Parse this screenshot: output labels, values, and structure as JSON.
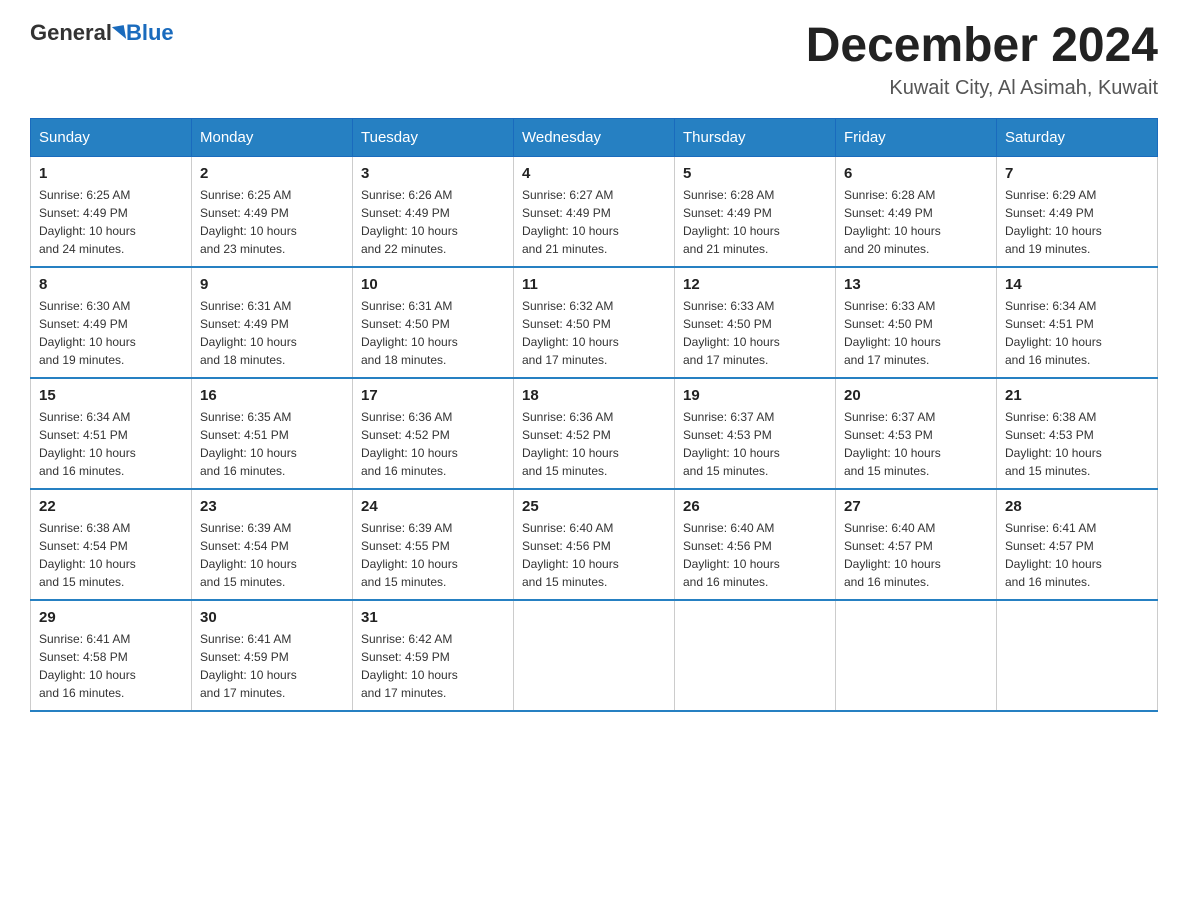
{
  "header": {
    "logo_general": "General",
    "logo_blue": "Blue",
    "month_title": "December 2024",
    "location": "Kuwait City, Al Asimah, Kuwait"
  },
  "days_of_week": [
    "Sunday",
    "Monday",
    "Tuesday",
    "Wednesday",
    "Thursday",
    "Friday",
    "Saturday"
  ],
  "weeks": [
    [
      {
        "day": "1",
        "sunrise": "6:25 AM",
        "sunset": "4:49 PM",
        "daylight": "10 hours and 24 minutes."
      },
      {
        "day": "2",
        "sunrise": "6:25 AM",
        "sunset": "4:49 PM",
        "daylight": "10 hours and 23 minutes."
      },
      {
        "day": "3",
        "sunrise": "6:26 AM",
        "sunset": "4:49 PM",
        "daylight": "10 hours and 22 minutes."
      },
      {
        "day": "4",
        "sunrise": "6:27 AM",
        "sunset": "4:49 PM",
        "daylight": "10 hours and 21 minutes."
      },
      {
        "day": "5",
        "sunrise": "6:28 AM",
        "sunset": "4:49 PM",
        "daylight": "10 hours and 21 minutes."
      },
      {
        "day": "6",
        "sunrise": "6:28 AM",
        "sunset": "4:49 PM",
        "daylight": "10 hours and 20 minutes."
      },
      {
        "day": "7",
        "sunrise": "6:29 AM",
        "sunset": "4:49 PM",
        "daylight": "10 hours and 19 minutes."
      }
    ],
    [
      {
        "day": "8",
        "sunrise": "6:30 AM",
        "sunset": "4:49 PM",
        "daylight": "10 hours and 19 minutes."
      },
      {
        "day": "9",
        "sunrise": "6:31 AM",
        "sunset": "4:49 PM",
        "daylight": "10 hours and 18 minutes."
      },
      {
        "day": "10",
        "sunrise": "6:31 AM",
        "sunset": "4:50 PM",
        "daylight": "10 hours and 18 minutes."
      },
      {
        "day": "11",
        "sunrise": "6:32 AM",
        "sunset": "4:50 PM",
        "daylight": "10 hours and 17 minutes."
      },
      {
        "day": "12",
        "sunrise": "6:33 AM",
        "sunset": "4:50 PM",
        "daylight": "10 hours and 17 minutes."
      },
      {
        "day": "13",
        "sunrise": "6:33 AM",
        "sunset": "4:50 PM",
        "daylight": "10 hours and 17 minutes."
      },
      {
        "day": "14",
        "sunrise": "6:34 AM",
        "sunset": "4:51 PM",
        "daylight": "10 hours and 16 minutes."
      }
    ],
    [
      {
        "day": "15",
        "sunrise": "6:34 AM",
        "sunset": "4:51 PM",
        "daylight": "10 hours and 16 minutes."
      },
      {
        "day": "16",
        "sunrise": "6:35 AM",
        "sunset": "4:51 PM",
        "daylight": "10 hours and 16 minutes."
      },
      {
        "day": "17",
        "sunrise": "6:36 AM",
        "sunset": "4:52 PM",
        "daylight": "10 hours and 16 minutes."
      },
      {
        "day": "18",
        "sunrise": "6:36 AM",
        "sunset": "4:52 PM",
        "daylight": "10 hours and 15 minutes."
      },
      {
        "day": "19",
        "sunrise": "6:37 AM",
        "sunset": "4:53 PM",
        "daylight": "10 hours and 15 minutes."
      },
      {
        "day": "20",
        "sunrise": "6:37 AM",
        "sunset": "4:53 PM",
        "daylight": "10 hours and 15 minutes."
      },
      {
        "day": "21",
        "sunrise": "6:38 AM",
        "sunset": "4:53 PM",
        "daylight": "10 hours and 15 minutes."
      }
    ],
    [
      {
        "day": "22",
        "sunrise": "6:38 AM",
        "sunset": "4:54 PM",
        "daylight": "10 hours and 15 minutes."
      },
      {
        "day": "23",
        "sunrise": "6:39 AM",
        "sunset": "4:54 PM",
        "daylight": "10 hours and 15 minutes."
      },
      {
        "day": "24",
        "sunrise": "6:39 AM",
        "sunset": "4:55 PM",
        "daylight": "10 hours and 15 minutes."
      },
      {
        "day": "25",
        "sunrise": "6:40 AM",
        "sunset": "4:56 PM",
        "daylight": "10 hours and 15 minutes."
      },
      {
        "day": "26",
        "sunrise": "6:40 AM",
        "sunset": "4:56 PM",
        "daylight": "10 hours and 16 minutes."
      },
      {
        "day": "27",
        "sunrise": "6:40 AM",
        "sunset": "4:57 PM",
        "daylight": "10 hours and 16 minutes."
      },
      {
        "day": "28",
        "sunrise": "6:41 AM",
        "sunset": "4:57 PM",
        "daylight": "10 hours and 16 minutes."
      }
    ],
    [
      {
        "day": "29",
        "sunrise": "6:41 AM",
        "sunset": "4:58 PM",
        "daylight": "10 hours and 16 minutes."
      },
      {
        "day": "30",
        "sunrise": "6:41 AM",
        "sunset": "4:59 PM",
        "daylight": "10 hours and 17 minutes."
      },
      {
        "day": "31",
        "sunrise": "6:42 AM",
        "sunset": "4:59 PM",
        "daylight": "10 hours and 17 minutes."
      },
      null,
      null,
      null,
      null
    ]
  ],
  "labels": {
    "sunrise": "Sunrise:",
    "sunset": "Sunset:",
    "daylight": "Daylight:"
  }
}
